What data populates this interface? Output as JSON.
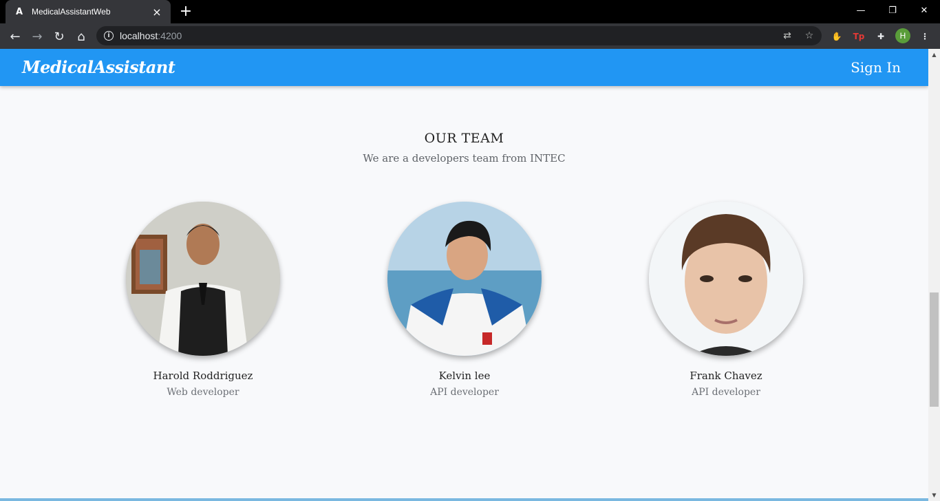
{
  "browser": {
    "tab_title": "MedicalAssistantWeb",
    "tab_favicon": "A",
    "url_host": "localhost",
    "url_port": ":4200",
    "profile_initial": "H",
    "extensions": [
      {
        "name": "adblock-icon",
        "glyph": "✋",
        "color": "#e53935"
      },
      {
        "name": "tp-extension-icon",
        "glyph": "Tp",
        "color": "#e53935"
      },
      {
        "name": "puzzle-extensions-icon",
        "glyph": "✚",
        "color": "#e8eaed"
      }
    ]
  },
  "navbar": {
    "brand": "MedicalAssistant",
    "signin_label": "Sign In",
    "color": "#2196f3"
  },
  "team": {
    "title": "OUR TEAM",
    "subtitle": "We are a developers team from INTEC",
    "members": [
      {
        "name": "Harold Roddriguez",
        "role": "Web developer"
      },
      {
        "name": "Kelvin lee",
        "role": "API developer"
      },
      {
        "name": "Frank Chavez",
        "role": "API developer"
      }
    ]
  }
}
